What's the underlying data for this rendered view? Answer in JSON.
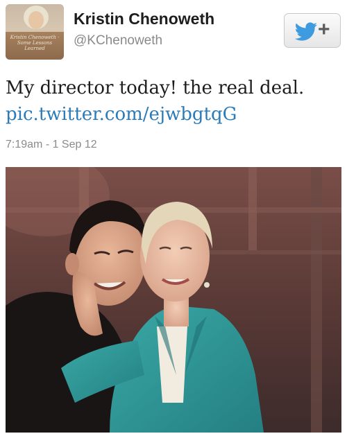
{
  "tweet": {
    "avatar_text": "Kristin Chenoweth · Some Lessons Learned",
    "display_name": "Kristin Chenoweth",
    "handle": "@KChenoweth",
    "text": "My director today! the real deal.",
    "link": "pic.twitter.com/ejwbgtqG",
    "timestamp": "7:19am - 1 Sep 12"
  },
  "follow_button": {
    "icon": "twitter-bird-icon",
    "plus": "+"
  },
  "colors": {
    "link": "#2b7bb9",
    "bird": "#3f9bdf",
    "jacket": "#2f9a9a"
  }
}
